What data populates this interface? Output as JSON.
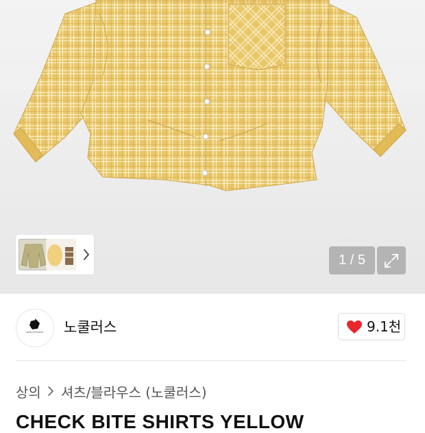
{
  "gallery": {
    "counter": "1 / 5",
    "thumbnail_count": 3,
    "shirt_color": "#e9c769",
    "check_color": "#ffffff"
  },
  "brand": {
    "name": "노쿨러스",
    "logo_text": "NON COOLRUS"
  },
  "likes": {
    "count": "9.1천",
    "heart_color": "#e8262c"
  },
  "breadcrumb": {
    "items": [
      "상의",
      "셔츠/블라우스 (노쿨러스)"
    ]
  },
  "product": {
    "title": "CHECK BITE SHIRTS YELLOW"
  },
  "icons": {
    "thumb_next": "chevron-right-icon",
    "expand": "expand-icon",
    "like": "heart-icon",
    "breadcrumb_sep": "chevron-right-icon"
  }
}
